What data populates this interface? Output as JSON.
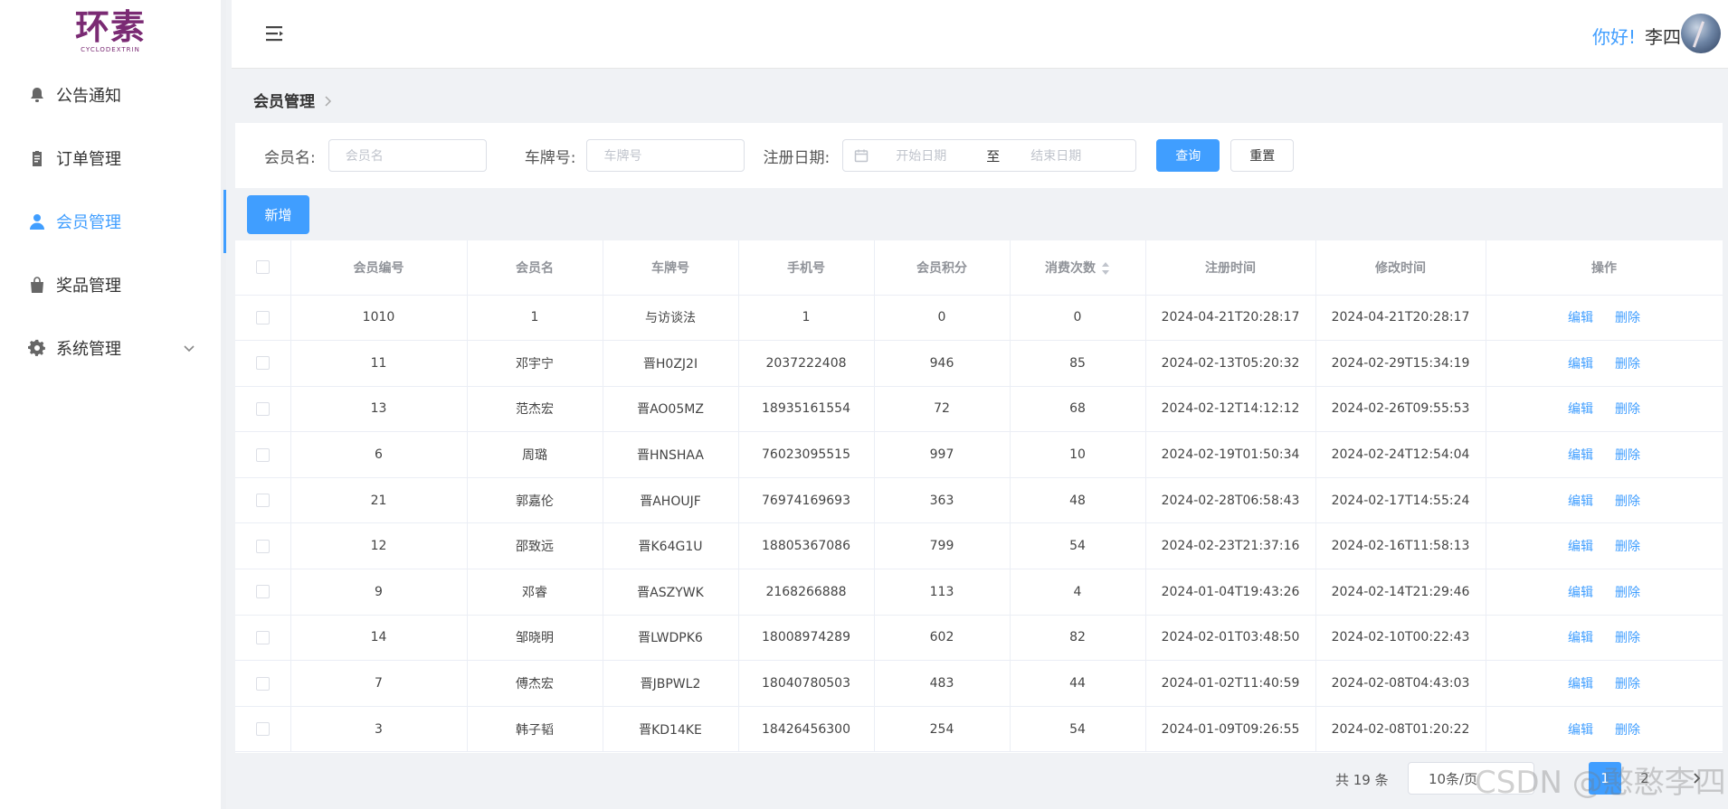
{
  "brand": {
    "logo_text": "环素",
    "logo_sub": "CYCLODEXTRIN"
  },
  "sidebar": {
    "items": [
      {
        "label": "公告通知",
        "icon": "bell-icon"
      },
      {
        "label": "订单管理",
        "icon": "clipboard-icon"
      },
      {
        "label": "会员管理",
        "icon": "user-icon",
        "active": true
      },
      {
        "label": "奖品管理",
        "icon": "bag-icon"
      },
      {
        "label": "系统管理",
        "icon": "gear-icon",
        "has_submenu": true
      }
    ]
  },
  "header": {
    "greeting": "你好!",
    "username": "李四"
  },
  "breadcrumb": {
    "current": "会员管理"
  },
  "search": {
    "member_name_label": "会员名:",
    "member_name_placeholder": "会员名",
    "plate_label": "车牌号:",
    "plate_placeholder": "车牌号",
    "reg_date_label": "注册日期:",
    "start_placeholder": "开始日期",
    "range_sep": "至",
    "end_placeholder": "结束日期",
    "query_label": "查询",
    "reset_label": "重置"
  },
  "toolbar": {
    "add_label": "新增"
  },
  "table": {
    "columns": [
      "会员编号",
      "会员名",
      "车牌号",
      "手机号",
      "会员积分",
      "消费次数",
      "注册时间",
      "修改时间",
      "操作"
    ],
    "edit_label": "编辑",
    "delete_label": "删除",
    "rows": [
      [
        "1010",
        "1",
        "与访谈法",
        "1",
        "0",
        "0",
        "2024-04-21T20:28:17",
        "2024-04-21T20:28:17"
      ],
      [
        "11",
        "邓宇宁",
        "晋H0ZJ2I",
        "2037222408",
        "946",
        "85",
        "2024-02-13T05:20:32",
        "2024-02-29T15:34:19"
      ],
      [
        "13",
        "范杰宏",
        "晋AO05MZ",
        "18935161554",
        "72",
        "68",
        "2024-02-12T14:12:12",
        "2024-02-26T09:55:53"
      ],
      [
        "6",
        "周璐",
        "晋HNSHAA",
        "76023095515",
        "997",
        "10",
        "2024-02-19T01:50:34",
        "2024-02-24T12:54:04"
      ],
      [
        "21",
        "郭嘉伦",
        "晋AHOUJF",
        "76974169693",
        "363",
        "48",
        "2024-02-28T06:58:43",
        "2024-02-17T14:55:24"
      ],
      [
        "12",
        "邵致远",
        "晋K64G1U",
        "18805367086",
        "799",
        "54",
        "2024-02-23T21:37:16",
        "2024-02-16T11:58:13"
      ],
      [
        "9",
        "邓睿",
        "晋ASZYWK",
        "2168266888",
        "113",
        "4",
        "2024-01-04T19:43:26",
        "2024-02-14T21:29:46"
      ],
      [
        "14",
        "邹晓明",
        "晋LWDPK6",
        "18008974289",
        "602",
        "82",
        "2024-02-01T03:48:50",
        "2024-02-10T00:22:43"
      ],
      [
        "7",
        "傅杰宏",
        "晋JBPWL2",
        "18040780503",
        "483",
        "44",
        "2024-01-02T11:40:59",
        "2024-02-08T04:43:03"
      ],
      [
        "3",
        "韩子韬",
        "晋KD14KE",
        "18426456300",
        "254",
        "54",
        "2024-01-09T09:26:55",
        "2024-02-08T01:20:22"
      ]
    ]
  },
  "pagination": {
    "total_text": "共 19 条",
    "page_size": "10条/页",
    "pages": [
      "1",
      "2"
    ],
    "current_page": "1"
  },
  "watermark": "CSDN @憨憨李四"
}
